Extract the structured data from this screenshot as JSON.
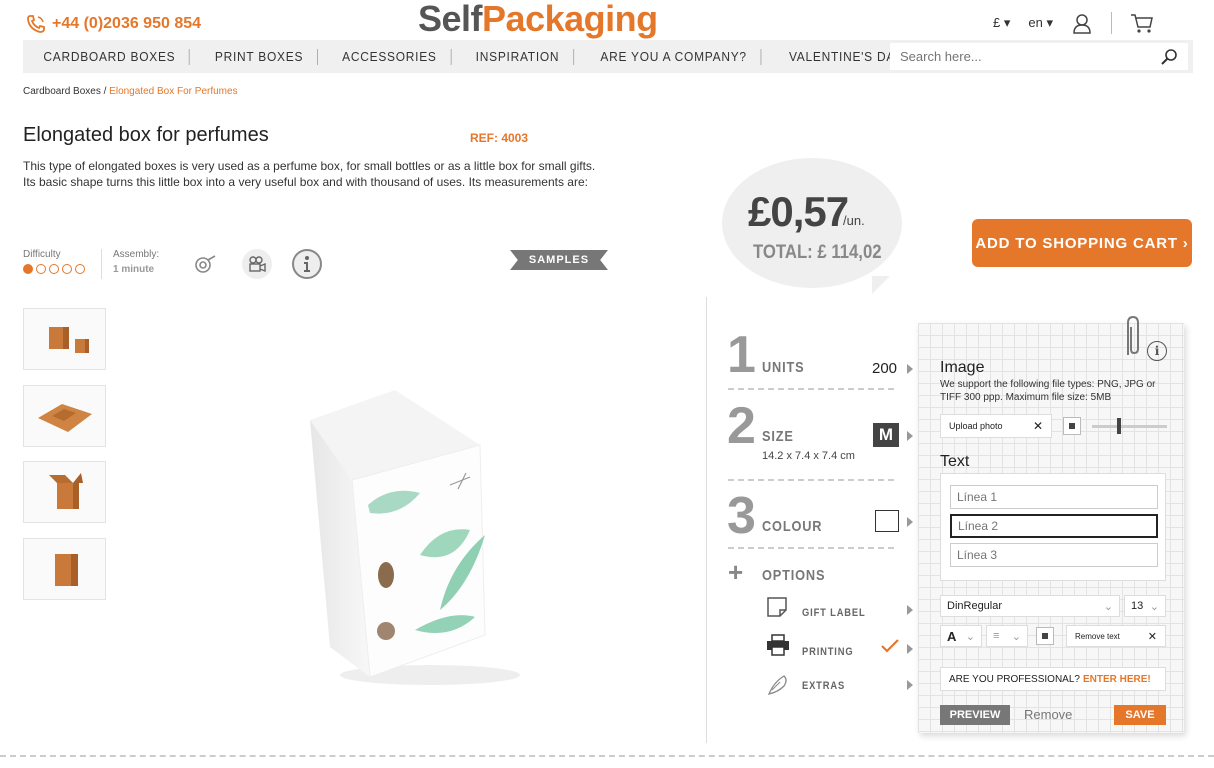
{
  "header": {
    "phone": "+44 (0)2036 950 854",
    "logo_self": "Self",
    "logo_packaging": "Packaging",
    "currency": "£",
    "language": "en"
  },
  "nav": {
    "items": [
      "CARDBOARD BOXES",
      "PRINT BOXES",
      "ACCESSORIES",
      "INSPIRATION",
      "ARE YOU A COMPANY?",
      "VALENTINE'S DAY"
    ],
    "search_placeholder": "Search here..."
  },
  "breadcrumb": {
    "parent": "Cardboard Boxes",
    "separator": "/",
    "current": "Elongated Box For Perfumes"
  },
  "product": {
    "title": "Elongated box for perfumes",
    "ref": "REF: 4003",
    "description": "This type of elongated boxes is very used as a perfume box, for small bottles or as a little box for small gifts. Its basic shape turns this little box into a very useful box and with thousand of uses. Its measurements are:",
    "difficulty_label": "Difficulty",
    "difficulty_level": 1,
    "difficulty_max": 5,
    "assembly_label": "Assembly:",
    "assembly_value": "1 minute",
    "samples_label": "SAMPLES"
  },
  "price": {
    "unit_price": "£0,57",
    "unit_suffix": "/un.",
    "total": "TOTAL: £ 114,02"
  },
  "cart_button": "ADD TO SHOPPING CART",
  "steps": [
    {
      "num": "1",
      "label": "UNITS",
      "value": "200"
    },
    {
      "num": "2",
      "label": "SIZE",
      "value": "M",
      "sub": "14.2 x 7.4 x 7.4 cm"
    },
    {
      "num": "3",
      "label": "COLOUR"
    }
  ],
  "options": {
    "label": "OPTIONS",
    "items": [
      {
        "label": "GIFT LABEL",
        "icon": "gift-label-icon"
      },
      {
        "label": "PRINTING",
        "icon": "printer-icon",
        "checked": true
      },
      {
        "label": "EXTRAS",
        "icon": "extras-icon"
      }
    ]
  },
  "editor": {
    "image_title": "Image",
    "image_info": "We support the following file types: PNG, JPG or TIFF 300 ppp. Maximum file size: 5MB",
    "upload_label": "Upload photo",
    "text_title": "Text",
    "lines": [
      "Línea 1",
      "Línea 2",
      "Línea 3"
    ],
    "font": "DinRegular",
    "font_size": "13",
    "color_label": "A",
    "remove_text": "Remove text",
    "professional_q": "ARE YOU PROFESSIONAL?",
    "professional_link": "ENTER HERE!",
    "preview": "PREVIEW",
    "remove": "Remove",
    "save": "SAVE"
  },
  "colors": {
    "accent": "#e5772a",
    "grey_text": "#777777"
  }
}
